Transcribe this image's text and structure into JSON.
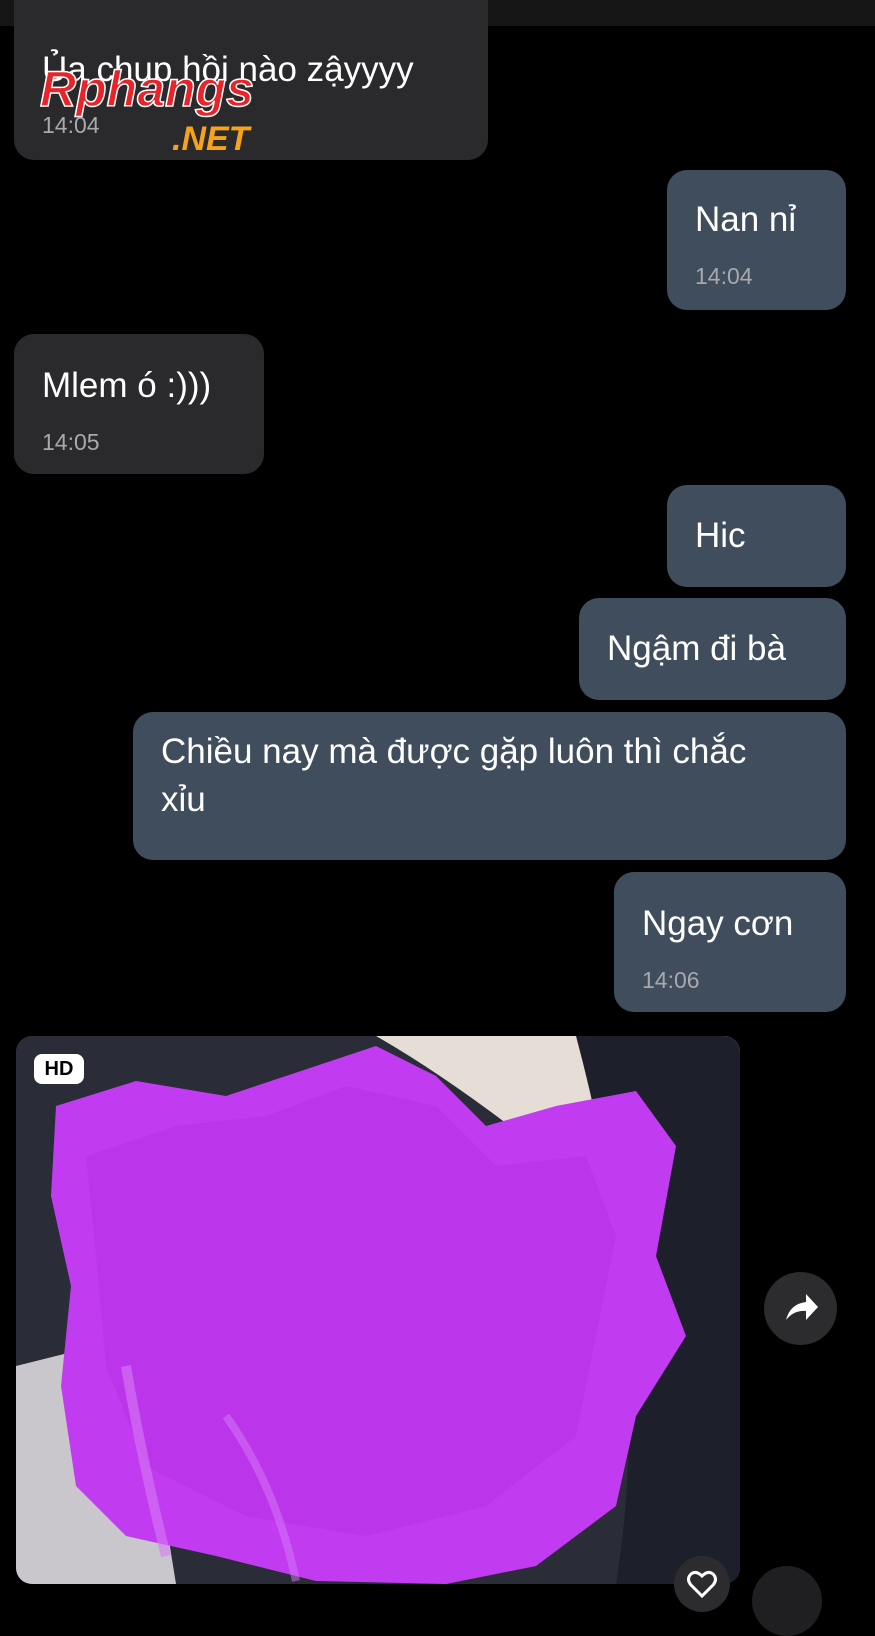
{
  "messages": [
    {
      "id": "m1",
      "text": "Ủa chụp hồi nào zậyyyy",
      "time": "14:04"
    },
    {
      "id": "m2",
      "text": "Nan nỉ",
      "time": "14:04"
    },
    {
      "id": "m3",
      "text": "Mlem ó :)))",
      "time": "14:05"
    },
    {
      "id": "m4",
      "text": "Hic"
    },
    {
      "id": "m5",
      "text": "Ngậm đi bà"
    },
    {
      "id": "m6",
      "lines": [
        "Chiều nay mà được gặp luôn thì chắc",
        "xỉu"
      ]
    },
    {
      "id": "m7",
      "text": "Ngay cơn",
      "time": "14:06"
    }
  ],
  "watermark": {
    "line1": "Rphangs",
    "line2": ".NET"
  },
  "photo": {
    "badge": "HD"
  },
  "icons": {
    "share": "share-arrow-icon",
    "like": "heart-icon"
  },
  "colors": {
    "background": "#000000",
    "incoming_bubble": "#2a2a2c",
    "outgoing_bubble": "#3f4d5c",
    "timestamp": "#a8a8ad",
    "censor": "#c13cf0",
    "watermark_red": "#e8232a",
    "watermark_orange": "#f7a21b"
  }
}
